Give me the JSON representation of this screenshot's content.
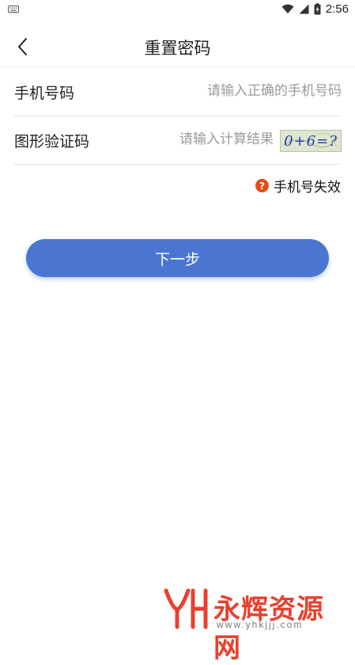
{
  "status_bar": {
    "time": "2:56",
    "icons": [
      "keyboard-icon",
      "wifi-icon",
      "signal-icon",
      "battery-icon"
    ]
  },
  "header": {
    "title": "重置密码",
    "back_icon": "chevron-left-icon"
  },
  "form": {
    "phone": {
      "label": "手机号码",
      "placeholder": "请输入正确的手机号码",
      "value": ""
    },
    "captcha": {
      "label": "图形验证码",
      "placeholder": "请输入计算结果",
      "value": "",
      "image_text": "0+6=?"
    }
  },
  "invalid_phone_link": {
    "icon": "question-circle-icon",
    "label": "手机号失效"
  },
  "next_button": {
    "label": "下一步"
  },
  "watermark": {
    "name": "永辉资源网",
    "url": "www.yhkjjj.com"
  },
  "colors": {
    "primary": "#4a76d2",
    "help_icon": "#e64a19",
    "watermark": "#e8402e"
  }
}
